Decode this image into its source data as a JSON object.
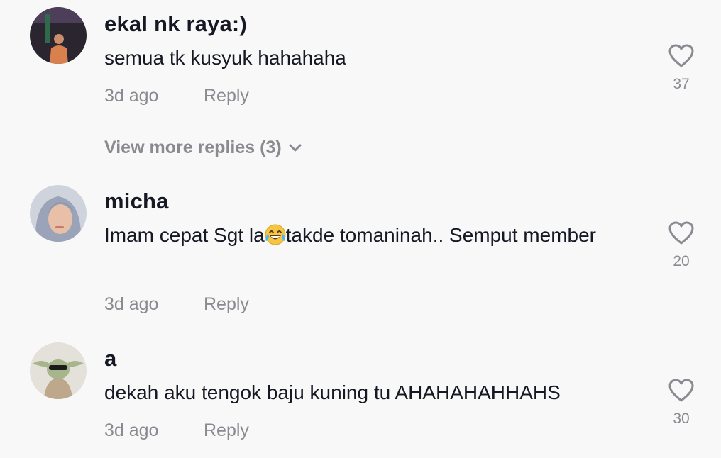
{
  "colors": {
    "background": "#f8f8f8",
    "text": "#161823",
    "muted": "#8a8b91"
  },
  "comments": [
    {
      "username": "ekal nk raya:)",
      "text": "semua tk kusyuk hahahaha",
      "time": "3d ago",
      "reply_label": "Reply",
      "likes": "37",
      "view_more": "View more replies (3)"
    },
    {
      "username": "micha",
      "text_before_emoji": "Imam cepat Sgt la",
      "emoji": "face-with-tears-of-joy",
      "text_after_emoji": "takde tomaninah.. Semput member",
      "time": "3d ago",
      "reply_label": "Reply",
      "likes": "20"
    },
    {
      "username": "a",
      "text": "dekah aku tengok baju kuning tu AHAHAHAHHAHS",
      "time": "3d ago",
      "reply_label": "Reply",
      "likes": "30"
    }
  ]
}
